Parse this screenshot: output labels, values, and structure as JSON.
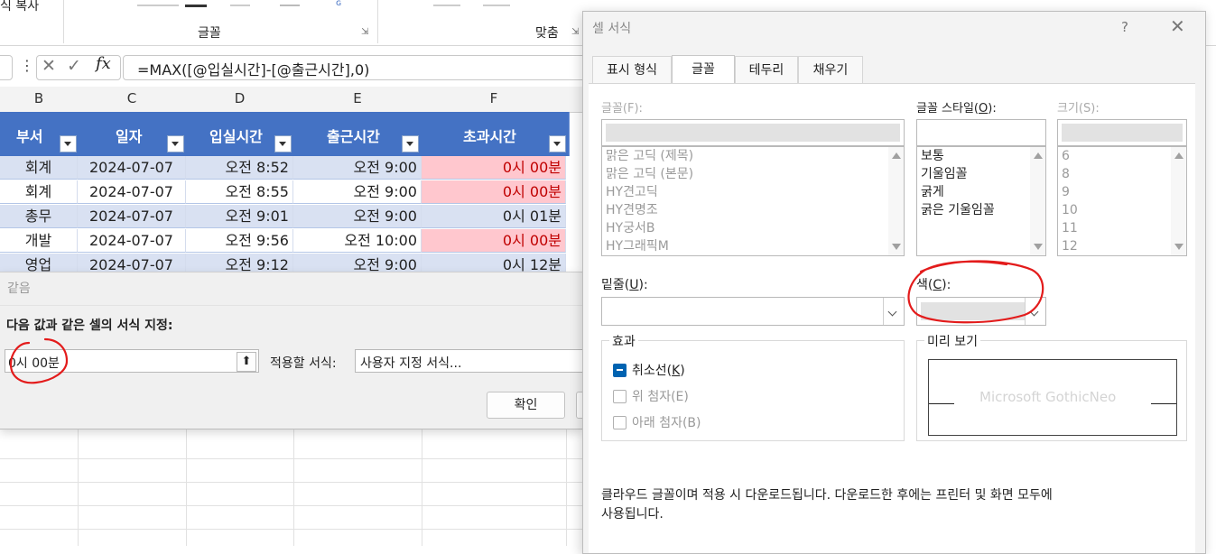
{
  "ribbon": {
    "copy_format": "식 복사",
    "group_font": "글꼴",
    "group_alignment": "맞춤"
  },
  "formula_bar": {
    "cancel_icon": "✕",
    "enter_icon": "✓",
    "fx_label": "fx",
    "formula": "=MAX([@입실시간]-[@출근시간],0)"
  },
  "columns": [
    "B",
    "C",
    "D",
    "E",
    "F"
  ],
  "table": {
    "headers": [
      "부서",
      "일자",
      "입실시간",
      "출근시간",
      "초과시간"
    ],
    "rows": [
      {
        "dept": "회계",
        "date": "2024-07-07",
        "entry": "오전 8:52",
        "start": "오전 9:00",
        "over": "0시 00분",
        "highlight": true
      },
      {
        "dept": "회계",
        "date": "2024-07-07",
        "entry": "오전 8:55",
        "start": "오전 9:00",
        "over": "0시 00분",
        "highlight": true
      },
      {
        "dept": "총무",
        "date": "2024-07-07",
        "entry": "오전 9:01",
        "start": "오전 9:00",
        "over": "0시 01분",
        "highlight": false
      },
      {
        "dept": "개발",
        "date": "2024-07-07",
        "entry": "오전 9:56",
        "start": "오전 10:00",
        "over": "0시 00분",
        "highlight": true
      },
      {
        "dept": "영업",
        "date": "2024-07-07",
        "entry": "오전 9:12",
        "start": "오전 9:00",
        "over": "0시 12분",
        "highlight": false
      }
    ]
  },
  "equal_dialog": {
    "title": "같음",
    "prompt": "다음 값과 같은 셀의 서식 지정:",
    "value": "0시 00분",
    "format_label": "적용할 서식:",
    "format_value": "사용자 지정 서식...",
    "ok": "확인"
  },
  "format_dialog": {
    "title": "셀 서식",
    "help": "?",
    "close": "✕",
    "tabs": [
      "표시 형식",
      "글꼴",
      "테두리",
      "채우기"
    ],
    "active_tab": "글꼴",
    "font_label": "글꼴(F):",
    "font_list": [
      "맑은 고딕 (제목)",
      "맑은 고딕 (본문)",
      "HY견고딕",
      "HY견명조",
      "HY궁서B",
      "HY그래픽M"
    ],
    "style_label_prefix": "글꼴 스타일(",
    "style_label_key": "O",
    "style_label_suffix": "):",
    "style_list": [
      "보통",
      "기울임꼴",
      "굵게",
      "굵은 기울임꼴"
    ],
    "size_label": "크기(S):",
    "size_list": [
      "6",
      "8",
      "9",
      "10",
      "11",
      "12"
    ],
    "underline_label_prefix": "밑줄(",
    "underline_label_key": "U",
    "underline_label_suffix": "):",
    "color_label_prefix": "색(",
    "color_label_key": "C",
    "color_label_suffix": "):",
    "effects_label": "효과",
    "strikethrough_prefix": "취소선(",
    "strikethrough_key": "K",
    "strikethrough_suffix": ")",
    "superscript": "위 첨자(E)",
    "subscript": "아래 첨자(B)",
    "preview_label": "미리 보기",
    "preview_text": "Microsoft GothicNeo",
    "note_line1": "클라우드 글꼴이며 적용 시 다운로드됩니다. 다운로드한 후에는 프린터 및 화면 모두에",
    "note_line2": "사용됩니다."
  },
  "colors": {
    "header_blue": "#4472c4",
    "band_blue": "#d9e1f2",
    "highlight_pink": "#ffc7ce",
    "highlight_red": "#c00000",
    "annotation_red": "#e31b1b",
    "checkbox_blue": "#0063b1"
  }
}
